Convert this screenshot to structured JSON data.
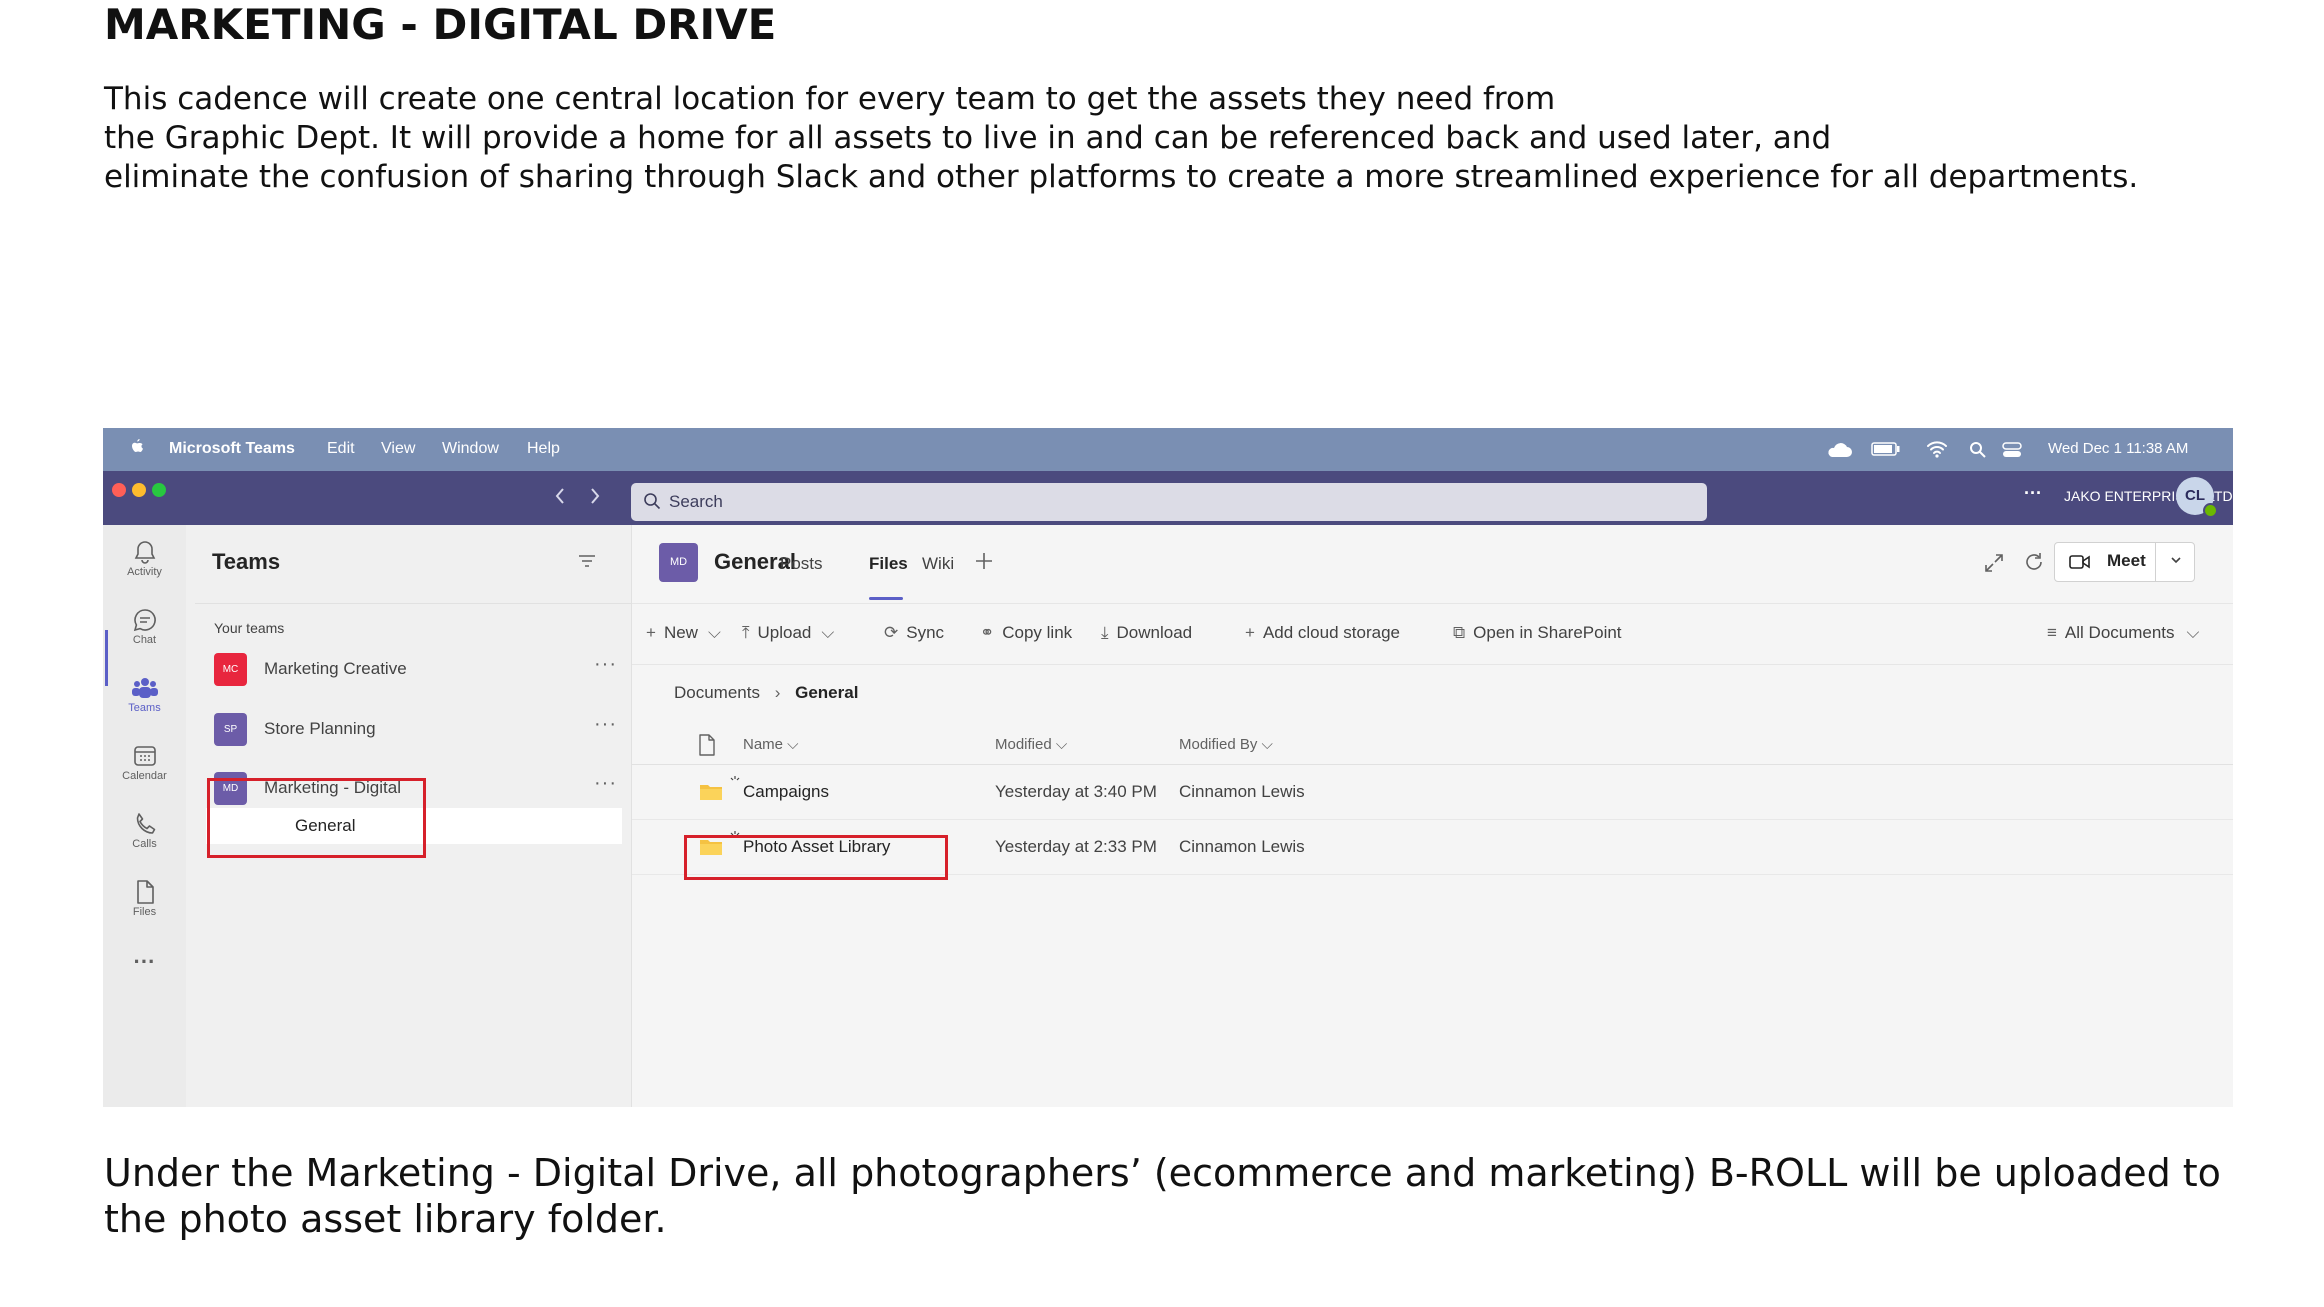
{
  "document": {
    "title": "MARKETING - DIGITAL DRIVE",
    "intro_lines": [
      "This cadence will create one central location for every team to get the assets they need from",
      "the Graphic Dept. It will provide a home for all assets to live in and can be referenced back and used later, and",
      "eliminate the confusion of sharing through Slack and other platforms to create a more streamlined experience for all departments."
    ],
    "outro": "Under the Marketing - Digital Drive, all photographers’ (ecommerce and marketing)  B-ROLL will be uploaded to the photo asset library folder."
  },
  "menubar": {
    "app": "Microsoft Teams",
    "items": [
      "Edit",
      "View",
      "Window",
      "Help"
    ],
    "datetime": "Wed Dec 1  11:38 AM"
  },
  "titlebar": {
    "search_placeholder": "Search",
    "more": "···",
    "org": "JAKO ENTERPRISES LTD",
    "avatar": "CL"
  },
  "rail": {
    "items": [
      {
        "label": "Activity",
        "icon": "bell-icon"
      },
      {
        "label": "Chat",
        "icon": "chat-icon"
      },
      {
        "label": "Teams",
        "icon": "teams-icon"
      },
      {
        "label": "Calendar",
        "icon": "calendar-icon"
      },
      {
        "label": "Calls",
        "icon": "phone-icon"
      },
      {
        "label": "Files",
        "icon": "file-icon"
      }
    ],
    "more": "···"
  },
  "teams_pane": {
    "title": "Teams",
    "section": "Your teams",
    "teams": [
      {
        "initials": "MC",
        "name": "Marketing Creative",
        "color": "#e8263e"
      },
      {
        "initials": "SP",
        "name": "Store Planning",
        "color": "#6c5ca8"
      },
      {
        "initials": "MD",
        "name": "Marketing - Digital",
        "color": "#6c5ca8"
      }
    ],
    "more": "···",
    "active_channel": "General"
  },
  "channel": {
    "initials": "MD",
    "name": "General",
    "tabs": [
      "Posts",
      "Files",
      "Wiki"
    ],
    "active_tab": "Files",
    "meet_label": "Meet"
  },
  "toolbar": {
    "new": "New",
    "upload": "Upload",
    "sync": "Sync",
    "copy_link": "Copy link",
    "download": "Download",
    "add_cloud": "Add cloud storage",
    "open_sharepoint": "Open in SharePoint",
    "view": "All Documents"
  },
  "breadcrumb": {
    "root": "Documents",
    "current": "General"
  },
  "files": {
    "columns": {
      "name": "Name",
      "modified": "Modified",
      "modified_by": "Modified By"
    },
    "rows": [
      {
        "name": "Campaigns",
        "modified": "Yesterday at 3:40 PM",
        "modified_by": "Cinnamon Lewis"
      },
      {
        "name": "Photo Asset Library",
        "modified": "Yesterday at 2:33 PM",
        "modified_by": "Cinnamon Lewis"
      }
    ]
  },
  "colors": {
    "menubar": "#7a8fb3",
    "titlebar": "#4b4a7e",
    "accent": "#5b5fc7",
    "highlight_box": "#d6202a",
    "folder": "#f5c242"
  }
}
